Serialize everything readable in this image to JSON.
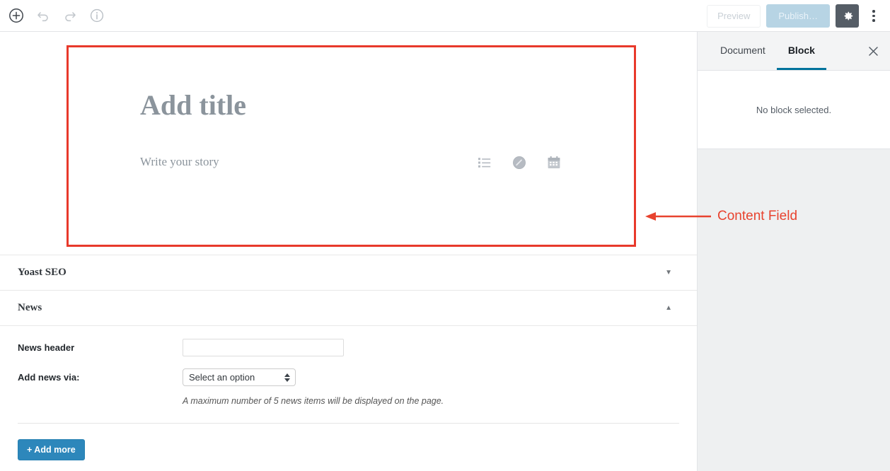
{
  "toolbar": {
    "add_block_icon": "plus-circle-icon",
    "undo_icon": "undo-icon",
    "redo_icon": "redo-icon",
    "info_icon": "info-circle-icon",
    "preview_label": "Preview",
    "publish_label": "Publish…",
    "settings_icon": "gear-icon",
    "more_icon": "more-vertical-icon"
  },
  "editor": {
    "title_placeholder": "Add title",
    "body_placeholder": "Write your story",
    "block_icons": [
      {
        "name": "list-icon"
      },
      {
        "name": "image-icon"
      },
      {
        "name": "calendar-icon"
      }
    ]
  },
  "annotation": {
    "label": "Content Field",
    "color": "#e8432f"
  },
  "metaboxes": [
    {
      "title": "Yoast SEO",
      "toggle": "▼",
      "expanded": false
    },
    {
      "title": "News",
      "toggle": "▲",
      "expanded": true
    }
  ],
  "news_form": {
    "header_label": "News header",
    "header_value": "",
    "header_placeholder": "",
    "via_label": "Add news via:",
    "via_selected": "Select an option",
    "helper_text": "A maximum number of 5 news items will be displayed on the page.",
    "add_more_label": "+ Add more"
  },
  "sidebar": {
    "tabs": [
      {
        "label": "Document",
        "active": false
      },
      {
        "label": "Block",
        "active": true
      }
    ],
    "close_icon": "close-icon",
    "empty_message": "No block selected.",
    "accent_color": "#00739c"
  }
}
